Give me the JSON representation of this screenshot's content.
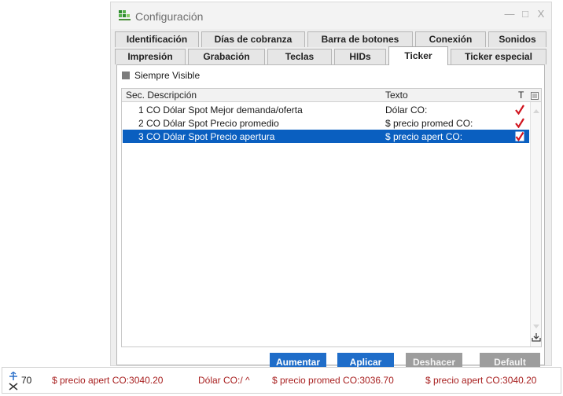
{
  "window": {
    "title": "Configuración",
    "minimize_glyph": "—",
    "maximize_glyph": "□",
    "close_glyph": "X"
  },
  "tabs_row1": [
    {
      "label": "Identificación"
    },
    {
      "label": "Días de cobranza"
    },
    {
      "label": "Barra de botones"
    },
    {
      "label": "Conexión"
    },
    {
      "label": "Sonidos"
    }
  ],
  "tabs_row2": [
    {
      "label": "Impresión"
    },
    {
      "label": "Grabación"
    },
    {
      "label": "Teclas"
    },
    {
      "label": "HIDs"
    },
    {
      "label": "Ticker",
      "active": true
    },
    {
      "label": "Ticker especial"
    }
  ],
  "options": {
    "siempre_visible_label": "Siempre Visible"
  },
  "table": {
    "columns": {
      "descripcion": "Sec. Descripción",
      "texto": "Texto",
      "t": "T"
    },
    "rows": [
      {
        "seq": "1",
        "descripcion": "CO Dólar Spot Mejor demanda/oferta",
        "texto": "Dólar CO:",
        "checked": true
      },
      {
        "seq": "2",
        "descripcion": "CO Dólar Spot Precio promedio",
        "texto": "$ precio promed CO:",
        "checked": true
      },
      {
        "seq": "3",
        "descripcion": "CO Dólar Spot Precio apertura",
        "texto": "$ precio apert CO:",
        "checked": true,
        "selected": true
      }
    ]
  },
  "buttons": {
    "aumentar": "Aumentar",
    "aplicar": "Aplicar",
    "deshacer": "Deshacer",
    "default": "Default"
  },
  "statusbar": {
    "value": "70",
    "ticker": [
      "$ precio apert CO:3040.20",
      "Dólar CO:/ ^",
      "$ precio promed CO:3036.70",
      "$ precio apert CO:3040.20"
    ]
  },
  "colors": {
    "accent": "#1f6dc9",
    "selection": "#0a5fc0",
    "check": "#d0141e",
    "ticker_text": "#a82020"
  }
}
